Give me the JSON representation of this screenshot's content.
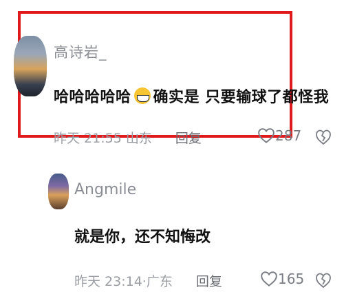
{
  "comments": [
    {
      "username": "高诗岩_",
      "text_before_emoji": "哈哈哈哈哈",
      "emoji": "grinning-face-emoji",
      "text_after_emoji": "确实是 只要输球了都怪我",
      "time": "昨天 21:55",
      "location": "山东",
      "reply_label": "回复",
      "likes": "287"
    },
    {
      "username": "Angmile",
      "text": "就是你，还不知悔改",
      "time": "昨天 23:14",
      "location": "广东",
      "reply_label": "回复",
      "likes": "165"
    }
  ],
  "colors": {
    "highlight": "#e0191d",
    "username": "#8a8d94",
    "meta": "#9a9da3"
  }
}
